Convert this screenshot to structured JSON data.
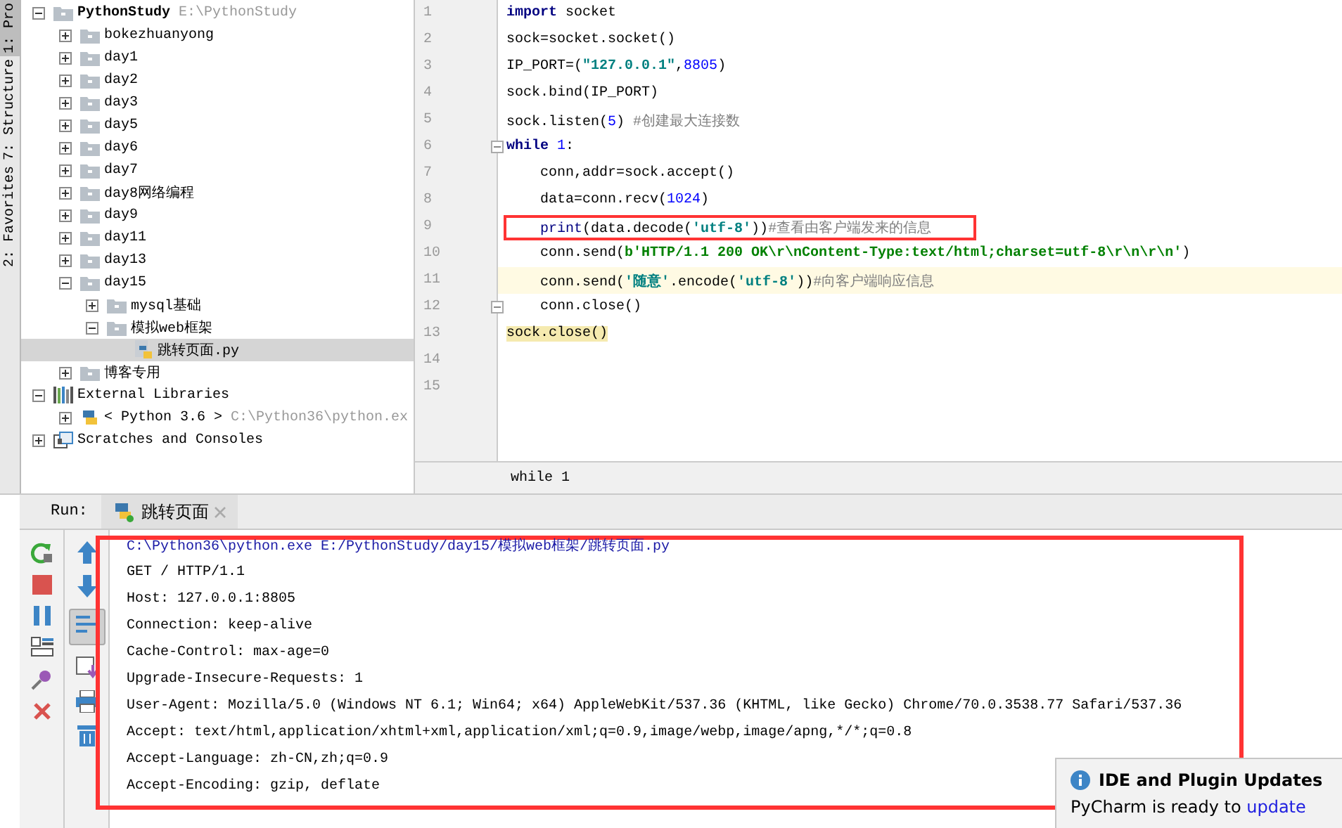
{
  "tool_strip": {
    "tabs": [
      {
        "label": "1: Pro",
        "selected": true
      },
      {
        "label": "7: Structure",
        "selected": false
      },
      {
        "label": "2: Favorites",
        "selected": false
      }
    ]
  },
  "project_tree": [
    {
      "label": "PythonStudy",
      "hint": "E:\\PythonStudy",
      "kind": "folder",
      "expanded": true,
      "selected": false,
      "children": [
        {
          "label": "bokezhuanyong",
          "kind": "folder",
          "expanded": false,
          "selected": false
        },
        {
          "label": "day1",
          "kind": "folder",
          "expanded": false,
          "selected": false
        },
        {
          "label": "day2",
          "kind": "folder",
          "expanded": false,
          "selected": false
        },
        {
          "label": "day3",
          "kind": "folder",
          "expanded": false,
          "selected": false
        },
        {
          "label": "day5",
          "kind": "folder",
          "expanded": false,
          "selected": false
        },
        {
          "label": "day6",
          "kind": "folder",
          "expanded": false,
          "selected": false
        },
        {
          "label": "day7",
          "kind": "folder",
          "expanded": false,
          "selected": false
        },
        {
          "label": "day8网络编程",
          "kind": "folder",
          "expanded": false,
          "selected": false
        },
        {
          "label": "day9",
          "kind": "folder",
          "expanded": false,
          "selected": false
        },
        {
          "label": "day11",
          "kind": "folder",
          "expanded": false,
          "selected": false
        },
        {
          "label": "day13",
          "kind": "folder",
          "expanded": false,
          "selected": false
        },
        {
          "label": "day15",
          "kind": "folder",
          "expanded": true,
          "selected": false,
          "children": [
            {
              "label": "mysql基础",
              "kind": "folder",
              "expanded": false,
              "selected": false
            },
            {
              "label": "模拟web框架",
              "kind": "folder",
              "expanded": true,
              "selected": false,
              "children": [
                {
                  "label": "跳转页面.py",
                  "kind": "python-file",
                  "selected": true
                }
              ]
            }
          ]
        },
        {
          "label": "博客专用",
          "kind": "folder",
          "expanded": false,
          "selected": false
        }
      ]
    },
    {
      "label": "External Libraries",
      "kind": "libraries",
      "expanded": true,
      "selected": false,
      "children": [
        {
          "label": "< Python 3.6 >",
          "hint": "C:\\Python36\\python.ex",
          "kind": "python-sdk",
          "expanded": false,
          "selected": false
        }
      ]
    },
    {
      "label": "Scratches and Consoles",
      "kind": "scratches",
      "expanded": false,
      "selected": false
    }
  ],
  "editor": {
    "lines": [
      {
        "number": "1",
        "tokens": [
          {
            "kind": "keyword",
            "text": "import"
          },
          {
            "kind": "plain",
            "text": " socket"
          }
        ]
      },
      {
        "number": "2",
        "tokens": [
          {
            "kind": "plain",
            "text": "sock=socket.socket()"
          }
        ]
      },
      {
        "number": "3",
        "tokens": [
          {
            "kind": "plain",
            "text": "IP_PORT=("
          },
          {
            "kind": "string",
            "text": "\"127.0.0.1\""
          },
          {
            "kind": "plain",
            "text": ","
          },
          {
            "kind": "number",
            "text": "8805"
          },
          {
            "kind": "plain",
            "text": ")"
          }
        ]
      },
      {
        "number": "4",
        "tokens": [
          {
            "kind": "plain",
            "text": "sock.bind(IP_PORT)"
          }
        ]
      },
      {
        "number": "5",
        "tokens": [
          {
            "kind": "plain",
            "text": "sock.listen("
          },
          {
            "kind": "number",
            "text": "5"
          },
          {
            "kind": "plain",
            "text": ") "
          },
          {
            "kind": "comment",
            "text": "#创建最大连接数"
          }
        ]
      },
      {
        "number": "6",
        "fold": true,
        "tokens": [
          {
            "kind": "keyword",
            "text": "while"
          },
          {
            "kind": "number",
            "text": " 1"
          },
          {
            "kind": "plain",
            "text": ":"
          }
        ]
      },
      {
        "number": "7",
        "tokens": [
          {
            "kind": "plain",
            "text": "    conn,addr=sock.accept()"
          }
        ]
      },
      {
        "number": "8",
        "tokens": [
          {
            "kind": "plain",
            "text": "    data=conn.recv("
          },
          {
            "kind": "number",
            "text": "1024"
          },
          {
            "kind": "plain",
            "text": ")"
          }
        ]
      },
      {
        "number": "9",
        "boxed": true,
        "tokens": [
          {
            "kind": "builtin",
            "text": "    print"
          },
          {
            "kind": "plain",
            "text": "(data.decode("
          },
          {
            "kind": "string",
            "text": "'utf-8'"
          },
          {
            "kind": "plain",
            "text": "))"
          },
          {
            "kind": "comment",
            "text": "#查看由客户端发来的信息"
          }
        ]
      },
      {
        "number": "10",
        "tokens": [
          {
            "kind": "plain",
            "text": "    conn.send("
          },
          {
            "kind": "bytes",
            "text": "b'HTTP/1.1 200 OK\\r\\nContent-Type:text/html;charset=utf-8\\r\\n\\r\\n'"
          },
          {
            "kind": "plain",
            "text": ")"
          }
        ]
      },
      {
        "number": "11",
        "current": true,
        "tokens": [
          {
            "kind": "plain",
            "text": "    conn.send("
          },
          {
            "kind": "string",
            "text": "'随意'"
          },
          {
            "kind": "plain",
            "text": ".encode("
          },
          {
            "kind": "string",
            "text": "'utf-8'"
          },
          {
            "kind": "plain",
            "text": "))"
          },
          {
            "kind": "comment",
            "text": "#向客户端响应信息"
          }
        ]
      },
      {
        "number": "12",
        "fold": true,
        "tokens": [
          {
            "kind": "plain",
            "text": "    conn.close()"
          }
        ]
      },
      {
        "number": "13",
        "tokens": [
          {
            "kind": "matched",
            "text": "sock.close()"
          }
        ]
      },
      {
        "number": "14"
      },
      {
        "number": "15"
      }
    ],
    "breadcrumb": "while 1"
  },
  "run_panel": {
    "label": "Run:",
    "tab": "跳转页面",
    "soft_wrap_on": true,
    "boxed": true,
    "console": [
      {
        "kind": "command",
        "text": "C:\\Python36\\python.exe E:/PythonStudy/day15/模拟web框架/跳转页面.py"
      },
      {
        "kind": "output",
        "text": "GET / HTTP/1.1"
      },
      {
        "kind": "output",
        "text": "Host: 127.0.0.1:8805"
      },
      {
        "kind": "output",
        "text": "Connection: keep-alive"
      },
      {
        "kind": "output",
        "text": "Cache-Control: max-age=0"
      },
      {
        "kind": "output",
        "text": "Upgrade-Insecure-Requests: 1"
      },
      {
        "kind": "output",
        "text": "User-Agent: Mozilla/5.0 (Windows NT 6.1; Win64; x64) AppleWebKit/537.36 (KHTML, like Gecko) Chrome/70.0.3538.77 Safari/537.36"
      },
      {
        "kind": "output",
        "text": "Accept: text/html,application/xhtml+xml,application/xml;q=0.9,image/webp,image/apng,*/*;q=0.8"
      },
      {
        "kind": "output",
        "text": "Accept-Language: zh-CN,zh;q=0.9"
      },
      {
        "kind": "output",
        "text": "Accept-Encoding: gzip, deflate"
      }
    ]
  },
  "notification": {
    "title": "IDE and Plugin Updates",
    "text": "PyCharm is ready to",
    "link": "update"
  }
}
